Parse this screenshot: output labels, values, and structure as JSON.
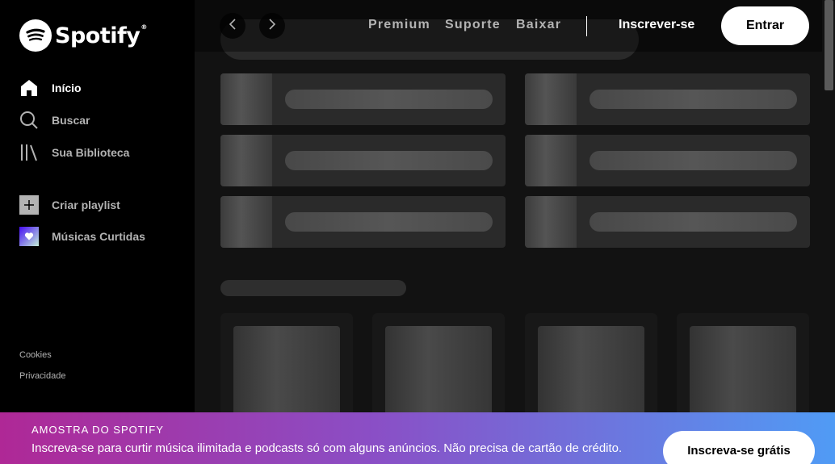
{
  "brand": {
    "name": "Spotify",
    "registered": "®"
  },
  "sidebar": {
    "nav": [
      {
        "label": "Início",
        "icon": "home-icon"
      },
      {
        "label": "Buscar",
        "icon": "search-icon"
      },
      {
        "label": "Sua Biblioteca",
        "icon": "library-icon"
      }
    ],
    "playlists": [
      {
        "label": "Criar playlist",
        "icon": "plus-icon"
      },
      {
        "label": "Músicas Curtidas",
        "icon": "heart-icon"
      }
    ],
    "footer": {
      "cookies": "Cookies",
      "privacy": "Privacidade"
    }
  },
  "topbar": {
    "links": [
      "Premium",
      "Suporte",
      "Baixar"
    ],
    "signup": "Inscrever-se",
    "login": "Entrar"
  },
  "banner": {
    "label": "AMOSTRA DO SPOTIFY",
    "text": "Inscreva-se para curtir música ilimitada e podcasts só com alguns anúncios. Não precisa de cartão de crédito.",
    "button": "Inscreva-se grátis"
  },
  "colors": {
    "background": "#121212",
    "sidebar": "#000000",
    "banner_start": "#af2896",
    "banner_end": "#509bf5",
    "liked_songs": "#7a5ee0"
  }
}
